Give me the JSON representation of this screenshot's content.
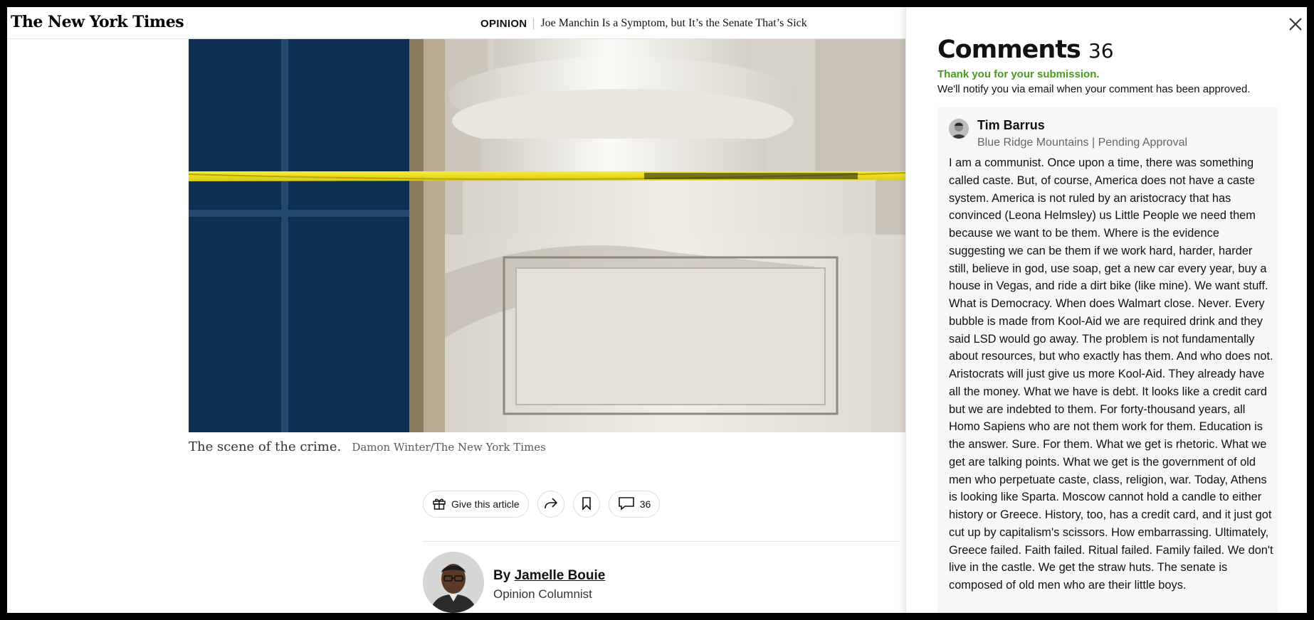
{
  "header": {
    "logo": "The New York Times",
    "section": "OPINION",
    "headline": "Joe Manchin Is a Symptom, but It’s the Senate That’s Sick"
  },
  "article": {
    "photo_alt": "Column base of a building with yellow police tape",
    "caption": "The scene of the crime.",
    "credit": "Damon Winter/The New York Times",
    "actions": {
      "gift_label": "Give this article",
      "share_icon": "share-icon",
      "bookmark_icon": "bookmark-icon",
      "comments_count": "36"
    },
    "byline": {
      "prefix": "By",
      "author": "Jamelle Bouie",
      "role": "Opinion Columnist"
    }
  },
  "comments_panel": {
    "title": "Comments",
    "count": "36",
    "submission_message": "Thank you for your submission.",
    "notify_message": "We'll notify you via email when your comment has been approved.",
    "comment": {
      "author": "Tim Barrus",
      "meta": "Blue Ridge Mountains | Pending Approval",
      "body": "I am a communist. Once upon a time, there was something called caste. But, of course, America does not have a caste system. America is not ruled by an aristocracy that has convinced (Leona Helmsley) us Little People we need them because we want to be them. Where is the evidence suggesting we can be them if we work hard, harder, harder still, believe in god, use soap, get a new car every year, buy a house in Vegas, and ride a dirt bike (like mine). We want stuff. What is Democracy. When does Walmart close. Never. Every bubble is made from Kool-Aid we are required drink and they said LSD would go away. The problem is not fundamentally about resources, but who exactly has them. And who does not. Aristocrats will just give us more Kool-Aid. They already have all the money. What we have is debt. It looks like a credit card but we are indebted to them. For forty-thousand years, all Homo Sapiens who are not them work for them. Education is the answer. Sure. For them. What we get is rhetoric. What we get are talking points. What we get is the government of old men who perpetuate caste, class, religion, war. Today, Athens is looking like Sparta. Moscow cannot hold a candle to either history or Greece. History, too, has a credit card, and it just got cut up by capitalism's scissors. How embarrassing. Ultimately, Greece failed. Faith failed. Ritual failed. Family failed. We don't live in the castle. We get the straw huts. The senate is composed of old men who are their little boys."
    }
  },
  "colors": {
    "success_green": "#4a9a20",
    "police_tape_yellow": "#f2e51a",
    "card_background": "#f7f7f7"
  }
}
